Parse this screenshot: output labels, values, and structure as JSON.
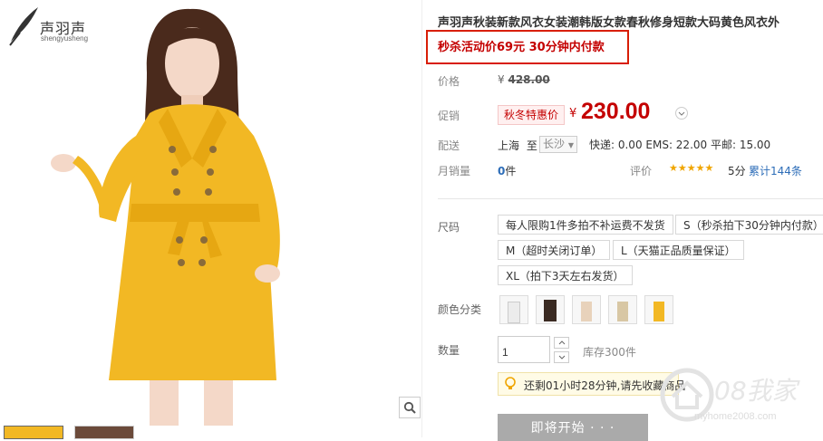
{
  "brand": {
    "name": "声羽声",
    "sub": "shengyusheng"
  },
  "product": {
    "title": "声羽声秋装新款风衣女装潮韩版女款春秋修身短款大码黄色风衣外",
    "promo": "秒杀活动价69元 30分钟内付款"
  },
  "price": {
    "label": "价格",
    "currency": "¥",
    "original": "428.00"
  },
  "promotion": {
    "label": "促销",
    "badge": "秋冬特惠价",
    "currency": "¥",
    "value": "230.00"
  },
  "delivery": {
    "label": "配送",
    "from": "上海",
    "to_word": "至",
    "city": "长沙",
    "shipping": "快递: 0.00 EMS: 22.00 平邮: 15.00"
  },
  "sales": {
    "label": "月销量",
    "count": "0",
    "unit": "件"
  },
  "reviews": {
    "label": "评价",
    "stars": "★★★★★",
    "score": "5分",
    "total": "累计144条"
  },
  "size": {
    "label": "尺码",
    "options": [
      "每人限购1件多拍不补运费不发货",
      "S（秒杀拍下30分钟内付款）",
      "M（超时关闭订单）",
      "L（天猫正品质量保证）",
      "XL（拍下3天左右发货）"
    ]
  },
  "color": {
    "label": "颜色分类"
  },
  "quantity": {
    "label": "数量",
    "value": "1",
    "stock": "库存300件"
  },
  "notice": {
    "text": "还剩01小时28分钟,请先收藏商品"
  },
  "button": {
    "start": "即将开始 · · ·"
  },
  "watermark": {
    "brand": "08我家",
    "url": "myhome2008.com"
  },
  "colors": {
    "accent": "#c40000",
    "coat": "#f2b824"
  }
}
